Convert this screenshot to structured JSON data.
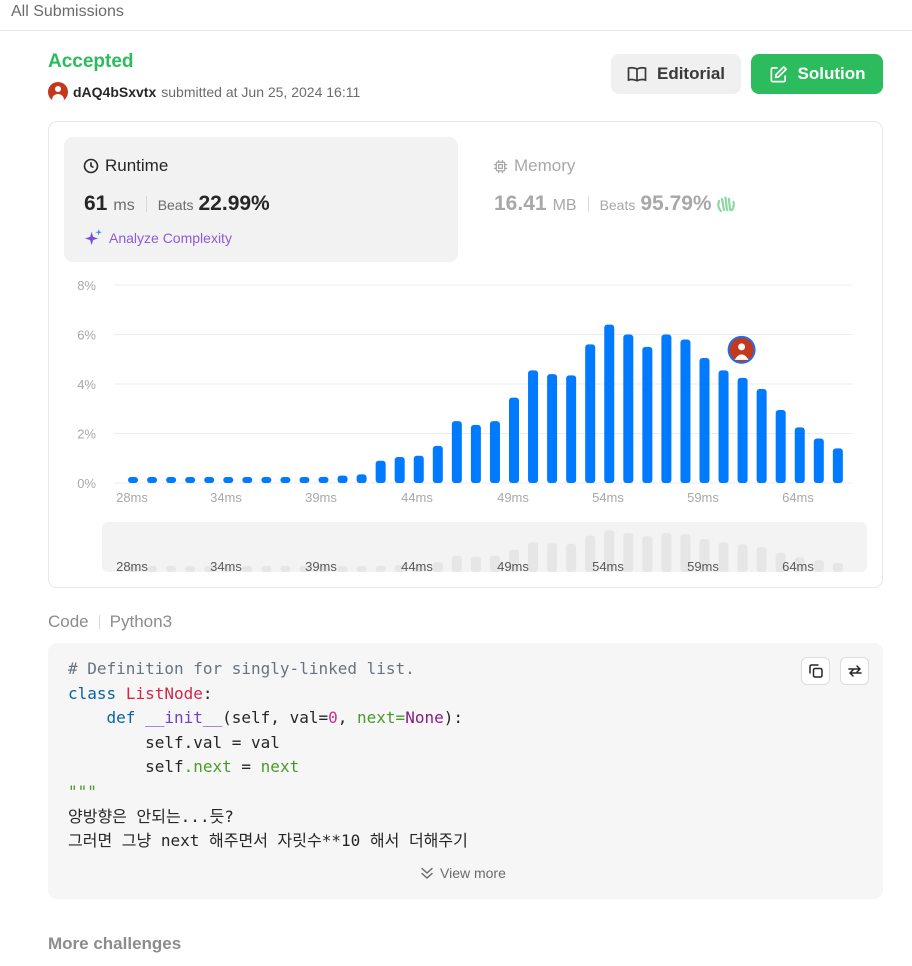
{
  "topbar": {
    "breadcrumb": "All Submissions"
  },
  "submission": {
    "status": "Accepted",
    "username": "dAQ4bSxvtx",
    "submitted_text": "submitted at Jun 25, 2024 16:11"
  },
  "actions": {
    "editorial_label": "Editorial",
    "solution_label": "Solution"
  },
  "runtime": {
    "title": "Runtime",
    "value": "61",
    "unit": "ms",
    "beats_label": "Beats",
    "beats_value": "22.99%",
    "analyze_label": "Analyze Complexity"
  },
  "memory": {
    "title": "Memory",
    "value": "16.41",
    "unit": "MB",
    "beats_label": "Beats",
    "beats_value": "95.79%"
  },
  "chart_data": {
    "type": "bar",
    "y_ticks": [
      "8%",
      "6%",
      "4%",
      "2%",
      "0%"
    ],
    "y_tick_values": [
      8,
      6,
      4,
      2,
      0
    ],
    "ylim": [
      0,
      8
    ],
    "grid": true,
    "x_tick_labels": [
      "28ms",
      "34ms",
      "39ms",
      "44ms",
      "49ms",
      "54ms",
      "59ms",
      "64ms"
    ],
    "values": [
      0.2,
      0.2,
      0.2,
      0.2,
      0.2,
      0.2,
      0.2,
      0.2,
      0.2,
      0.2,
      0.25,
      0.3,
      0.35,
      0.9,
      1.05,
      1.1,
      1.5,
      2.5,
      2.35,
      2.5,
      3.45,
      4.55,
      4.4,
      4.35,
      5.6,
      6.4,
      6.0,
      5.5,
      6.0,
      5.8,
      5.05,
      4.55,
      4.25,
      3.8,
      2.95,
      2.25,
      1.8,
      1.4
    ],
    "highlight_index": 32,
    "bar_color": "#007aff",
    "overview_color": "#e6e6e6",
    "overview_bg": "#f3f3f3"
  },
  "code_section": {
    "label": "Code",
    "language": "Python3",
    "view_more_label": "View more"
  },
  "code_lines": {
    "l1": "# Definition for singly-linked list.",
    "l2_kw": "class",
    "l2_name": "ListNode",
    "l3_kw": "def",
    "l3_fn": "__init__",
    "l3_a": "(self, val=",
    "l3_num": "0",
    "l3_b": ", ",
    "l3_next": "next",
    "l3_eq": "=",
    "l3_none": "None",
    "l3_end": "):",
    "l4_a": "self",
    "l4_b": ".val = val",
    "l5_a": "self",
    "l5_attr": ".next",
    "l5_eq": " = ",
    "l5_next": "next",
    "l6": "\"\"\"",
    "l7": "양방향은 안되는...듯?",
    "l8": "그러면 그냥 next 해주면서 자릿수**10 해서 더해주기"
  },
  "footer": {
    "more_challenges": "More challenges"
  },
  "colors": {
    "accepted": "#2cbb5d",
    "solution_btn": "#2cbb5d",
    "analyze": "#8e5bdb",
    "bar": "#007aff"
  },
  "icons": [
    "book-icon",
    "edit-icon",
    "clock-icon",
    "chip-icon",
    "sparkle-icon",
    "wave-icon",
    "copy-icon",
    "swap-icon",
    "chevrons-down-icon",
    "avatar"
  ]
}
